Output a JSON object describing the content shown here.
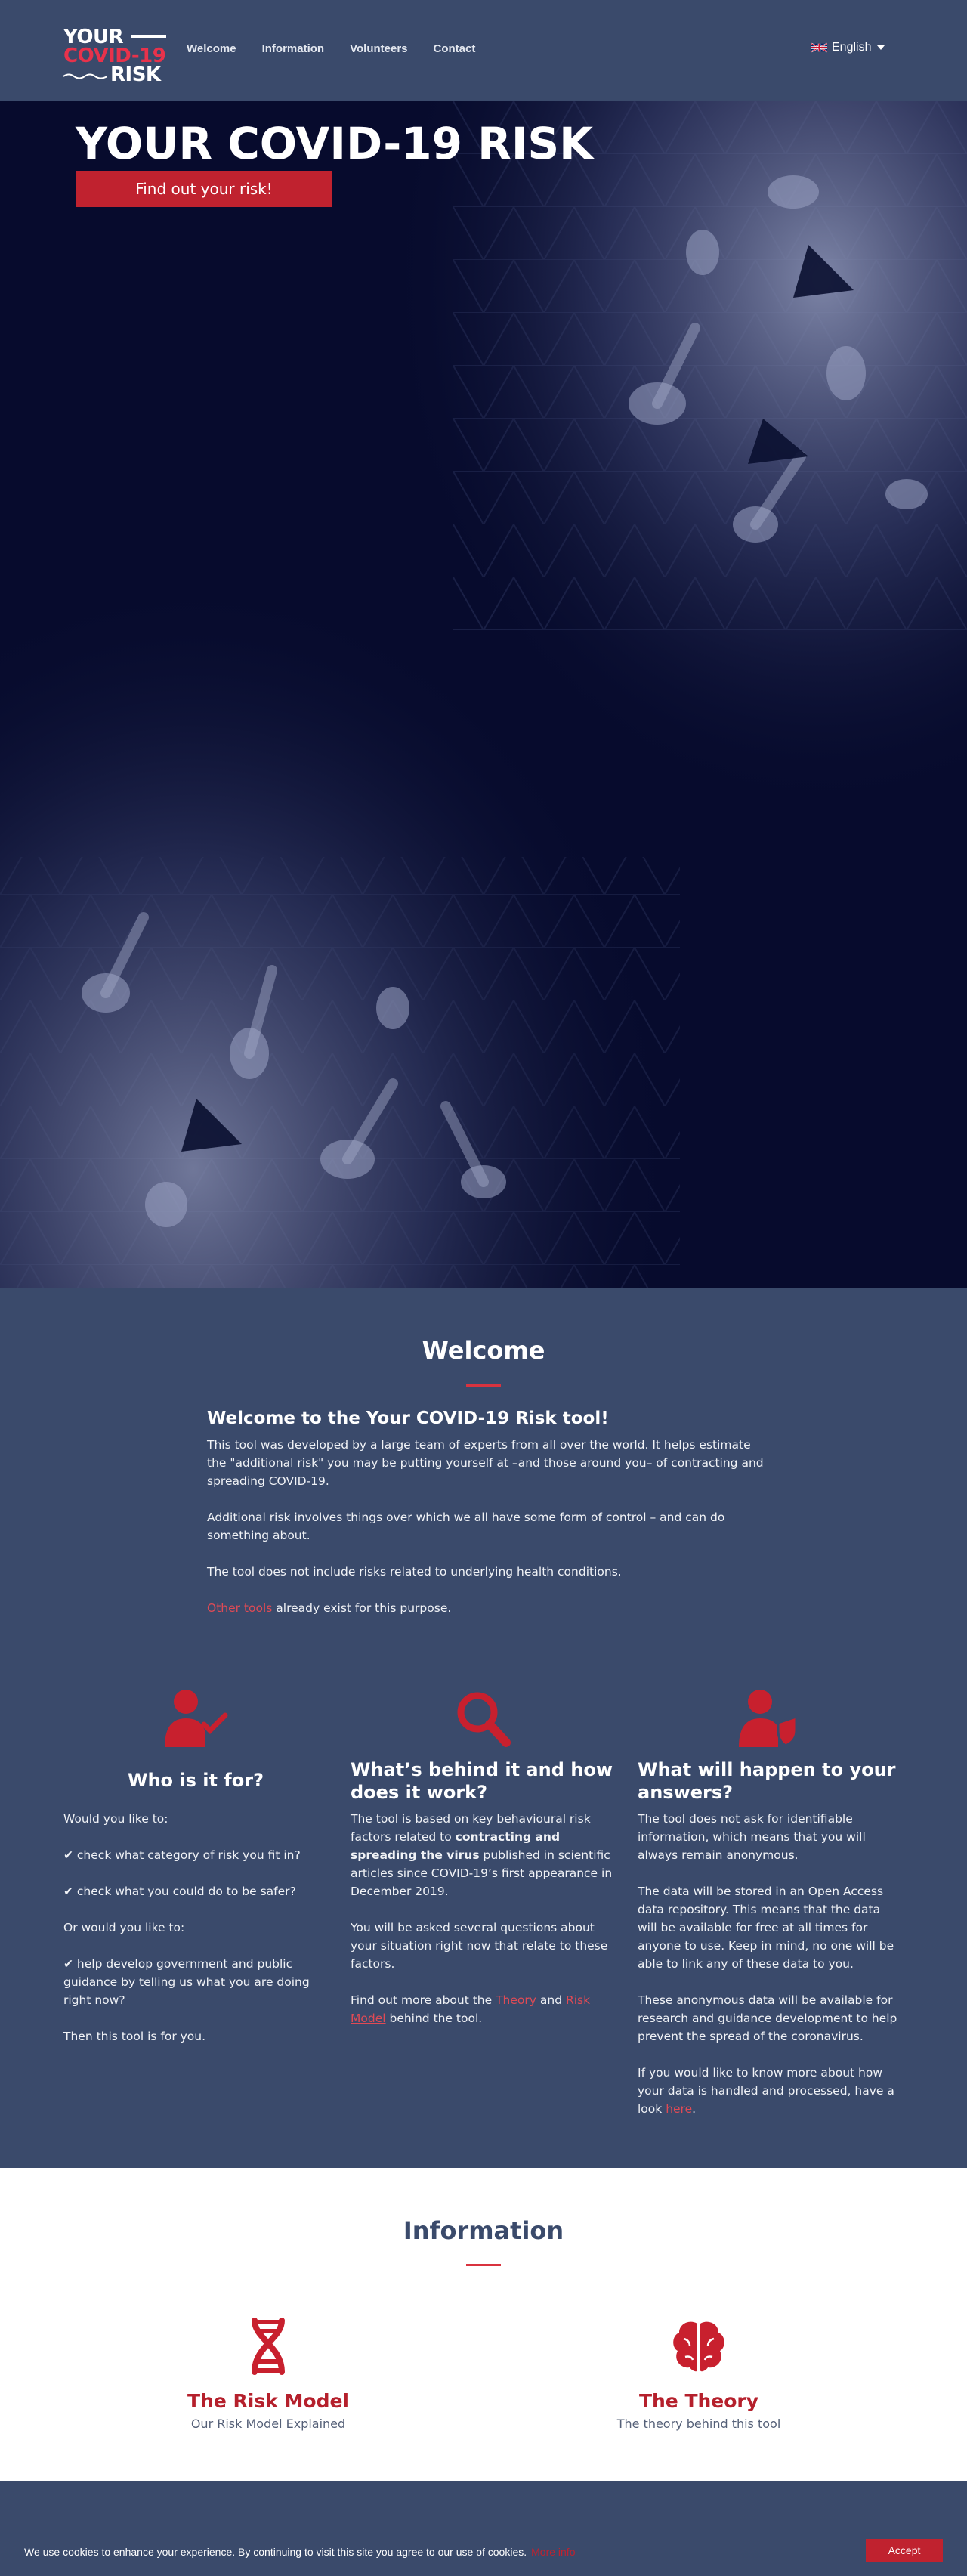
{
  "logo": {
    "line1": "YOUR",
    "line2": "COVID-19",
    "line3": "RISK"
  },
  "nav": {
    "links": [
      "Welcome",
      "Information",
      "Volunteers",
      "Contact"
    ],
    "language": "English",
    "language_flag": "uk-flag-icon"
  },
  "hero": {
    "title": "YOUR COVID-19 RISK",
    "button": "Find out your risk!"
  },
  "welcome": {
    "title": "Welcome",
    "heading": "Welcome to the Your COVID-19 Risk tool!",
    "p1": "This tool was developed by a large team of experts from all over the world. It helps estimate the \"additional risk\" you may be putting yourself at –and those around you– of contracting and spreading COVID-19.",
    "p2": "Additional risk involves things over which we all have some form of control – and can do something about.",
    "p3": "The tool does not include risks related to underlying health conditions.",
    "p4_link": "Other tools",
    "p4_rest": " already exist for this purpose."
  },
  "features": {
    "who": {
      "icon": "user-check-icon",
      "title": "Who is it for?",
      "lines": [
        "Would you like to:",
        "✔ check what category of risk you fit in?",
        "✔ check what you could do to be safer?",
        "Or would you like to:",
        "✔ help develop government and public guidance by telling us what you are doing right now?",
        "Then this tool is for you."
      ]
    },
    "behind": {
      "icon": "search-icon",
      "title": "What’s behind it and how does it work?",
      "p1_a": "The tool is based on key behavioural risk factors related to ",
      "p1_b": "contracting and spreading the virus",
      "p1_c": " published in scientific articles since COVID-19’s first appearance in December 2019.",
      "p2": "You will be asked several questions about your situation right now that relate to these factors.",
      "p3_a": "Find out more about the ",
      "p3_link1": "Theory",
      "p3_b": " and ",
      "p3_link2": "Risk Model",
      "p3_c": " behind the tool."
    },
    "answers": {
      "icon": "user-shield-icon",
      "title": "What will happen to your answers?",
      "p1": "The tool does not ask for identifiable information, which means that you will always remain anonymous.",
      "p2": "The data will be stored in an Open Access data repository. This means that the data will be available for free at all times for anyone to use. Keep in mind, no one will be able to link any of these data to you.",
      "p3": "These anonymous data will be available for research and guidance development to help prevent the spread of the coronavirus.",
      "p4_a": "If you would like to know more about how your data is handled and processed, have a look ",
      "p4_link": "here",
      "p4_b": "."
    }
  },
  "information": {
    "title": "Information",
    "cards": [
      {
        "icon": "dna-icon",
        "title": "The Risk Model",
        "subtitle": "Our Risk Model Explained"
      },
      {
        "icon": "brain-icon",
        "title": "The Theory",
        "subtitle": "The theory behind this tool"
      }
    ]
  },
  "cookie": {
    "text": "We use cookies to enhance your experience. By continuing to visit this site you agree to our use of cookies.",
    "more": "More info",
    "accept": "Accept"
  },
  "colors": {
    "navy": "#3a4a6b",
    "red": "#c0222f",
    "hero_bg": "#070b2d"
  }
}
